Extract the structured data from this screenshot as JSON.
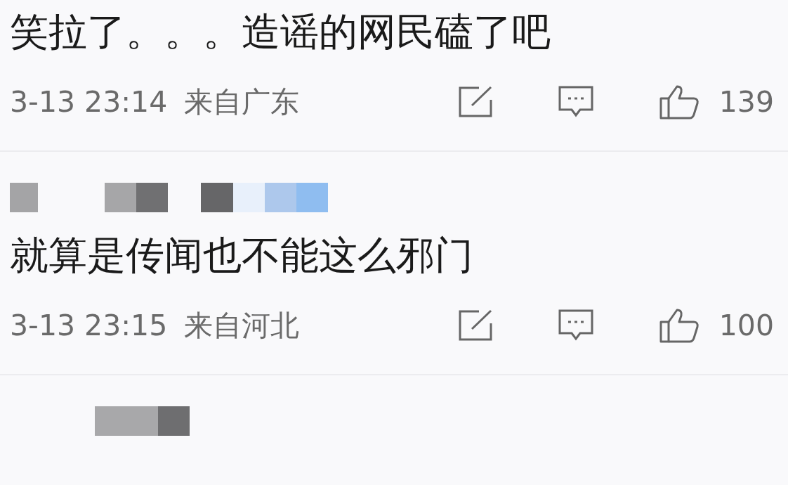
{
  "comments": [
    {
      "author_masked": false,
      "text": "笑拉了。。。造谣的网民磕了吧",
      "time": "3-13 23:14",
      "location": "来自广东",
      "likes": "139"
    },
    {
      "author_masked": true,
      "text": "就算是传闻也不能这么邪门",
      "time": "3-13 23:15",
      "location": "来自河北",
      "likes": "100"
    },
    {
      "author_masked": true
    }
  ]
}
